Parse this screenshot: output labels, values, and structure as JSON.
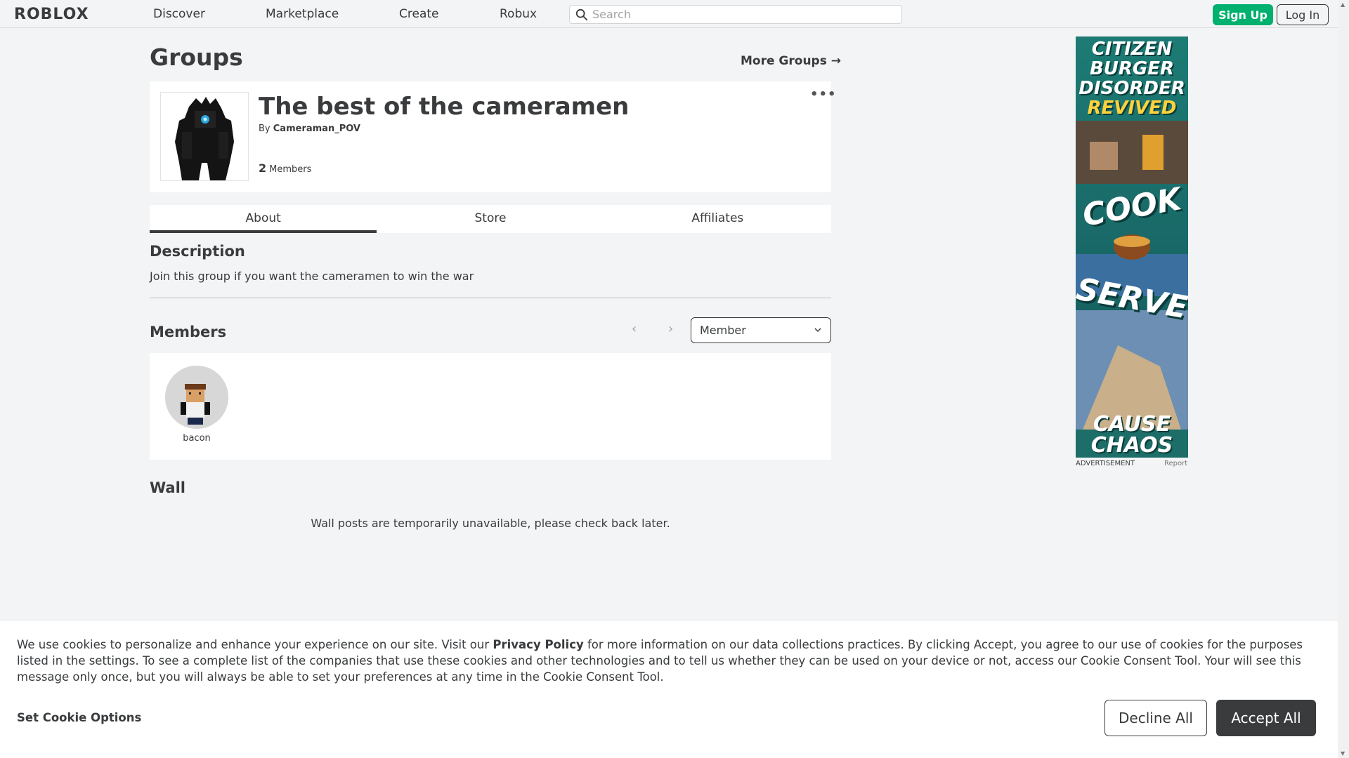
{
  "nav": {
    "logo": "ROBLOX",
    "links": [
      "Discover",
      "Marketplace",
      "Create",
      "Robux"
    ],
    "search_placeholder": "Search",
    "signup_label": "Sign Up",
    "login_label": "Log In"
  },
  "page": {
    "title": "Groups",
    "more_groups_label": "More Groups →"
  },
  "group": {
    "name": "The best of the cameramen",
    "by_prefix": "By",
    "owner": "Cameraman_POV",
    "member_count": "2",
    "members_label": "Members",
    "more_options": "•••"
  },
  "tabs": [
    "About",
    "Store",
    "Affiliates"
  ],
  "about": {
    "description_title": "Description",
    "description_text": "Join this group if you want the cameramen to win the war"
  },
  "members": {
    "title": "Members",
    "role_selected": "Member",
    "list": [
      {
        "name": "bacon"
      }
    ]
  },
  "wall": {
    "title": "Wall",
    "message": "Wall posts are temporarily unavailable, please check back later."
  },
  "ad": {
    "lines": [
      "CITIZEN",
      "BURGER",
      "DISORDER",
      "REVIVED",
      "COOK",
      "SERVE",
      "CAUSE",
      "CHAOS"
    ],
    "label": "ADVERTISEMENT",
    "report": "Report"
  },
  "cookie": {
    "text_before": "We use cookies to personalize and enhance your experience on our site. Visit our ",
    "privacy_link": "Privacy Policy",
    "text_after": " for more information on our data collections practices. By clicking Accept, you agree to our use of cookies for the purposes listed in the settings. To see a complete list of the companies that use these cookies and other technologies and to tell us whether they can be used on your device or not, access our Cookie Consent Tool. Your will see this message only once, but you will always be able to set your preferences at any time in the Cookie Consent Tool.",
    "options_label": "Set Cookie Options",
    "decline_label": "Decline All",
    "accept_label": "Accept All"
  },
  "colors": {
    "signup_green": "#00b06f",
    "text_dark": "#393b3d",
    "page_bg": "#f2f4f5"
  }
}
